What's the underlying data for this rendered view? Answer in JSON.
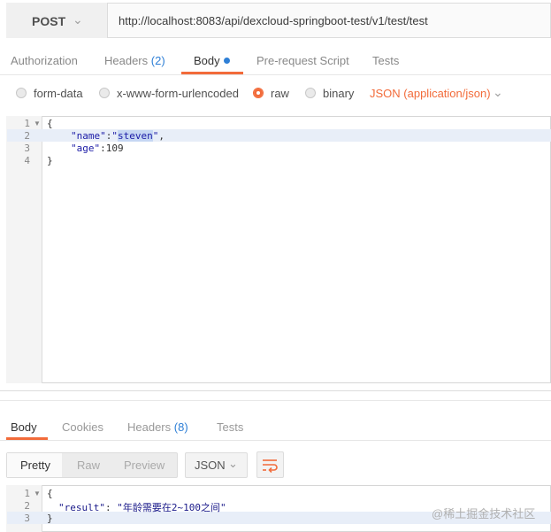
{
  "request": {
    "method": "POST",
    "url": "http://localhost:8083/api/dexcloud-springboot-test/v1/test/test"
  },
  "request_tabs": {
    "authorization": "Authorization",
    "headers": "Headers",
    "headers_count": "(2)",
    "body": "Body",
    "pre_request": "Pre-request Script",
    "tests": "Tests"
  },
  "body_types": {
    "form_data": "form-data",
    "urlencoded": "x-www-form-urlencoded",
    "raw": "raw",
    "binary": "binary",
    "content_type": "JSON (application/json)",
    "selected": "raw"
  },
  "request_editor": {
    "line_numbers": [
      "1",
      "2",
      "3",
      "4"
    ],
    "lines": {
      "l1": "{",
      "l2_key": "\"name\"",
      "l2_colon": ":",
      "l2_q1": "\"",
      "l2_sel": "steven",
      "l2_q2": "\"",
      "l2_comma": ",",
      "l3_key": "\"age\"",
      "l3_rest": ":109",
      "l4": "}"
    }
  },
  "response_tabs": {
    "body": "Body",
    "cookies": "Cookies",
    "headers": "Headers",
    "headers_count": "(8)",
    "tests": "Tests"
  },
  "view_controls": {
    "pretty": "Pretty",
    "raw": "Raw",
    "preview": "Preview",
    "format": "JSON",
    "active": "Pretty"
  },
  "response_editor": {
    "line_numbers": [
      "1",
      "2",
      "3"
    ],
    "l1": "{",
    "l2_key": "\"result\"",
    "l2_colon": ": ",
    "l2_value": "\"年龄需要在2~100之间\"",
    "l3": "}"
  },
  "watermark": "@稀土掘金技术社区",
  "colors": {
    "accent": "#f26b3a",
    "link_blue": "#2e7fd6"
  }
}
